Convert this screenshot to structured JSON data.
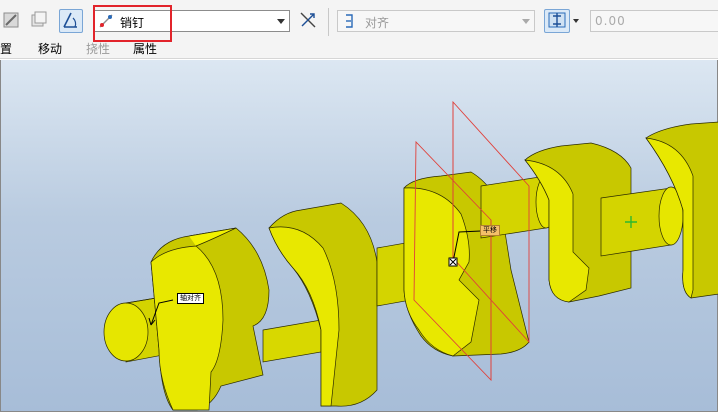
{
  "toolbar": {
    "constraint_type": "销钉",
    "align_combo": "对齐",
    "offset_value": "0.00"
  },
  "tabs": [
    {
      "label": "置"
    },
    {
      "label": "移动"
    },
    {
      "label": "挠性"
    },
    {
      "label": "属性"
    }
  ],
  "viewport": {
    "tag_left": "轴对齐",
    "tag_center": "平移"
  },
  "colors": {
    "part_yellow": "#e3e300",
    "highlight_red": "#e2242b",
    "datum_plane": "#e0403a"
  }
}
